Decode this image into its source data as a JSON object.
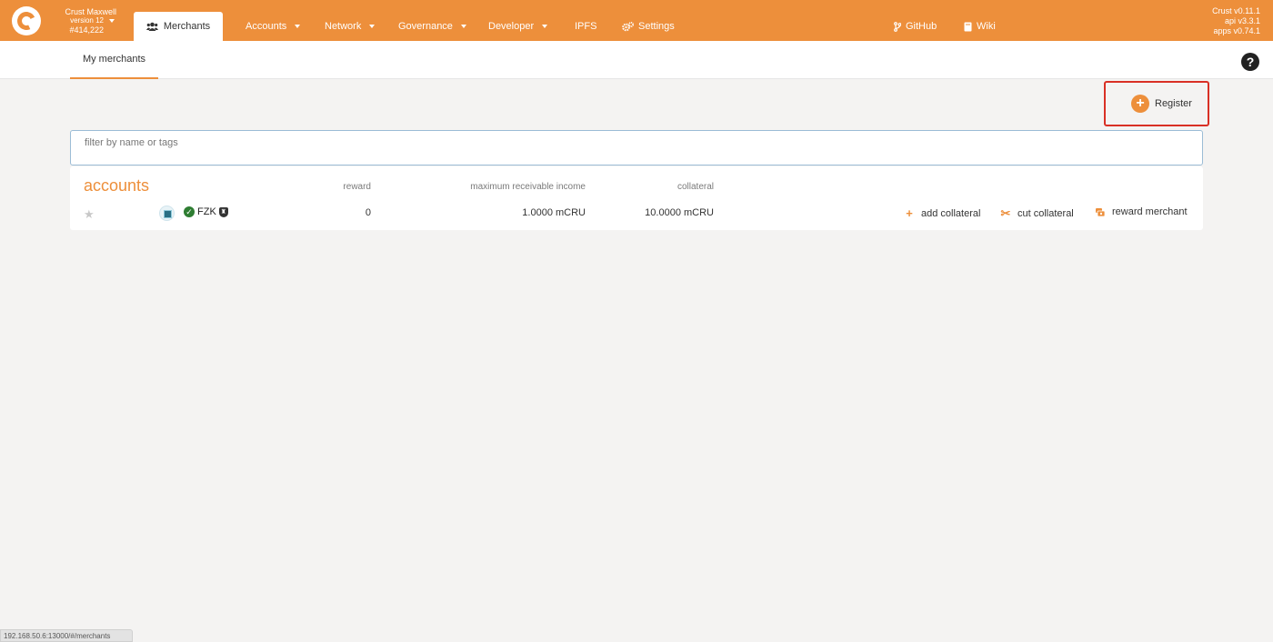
{
  "header": {
    "chain_name": "Crust Maxwell",
    "version": "version 12",
    "block": "#414,222",
    "active_tab": "Merchants",
    "nav": [
      {
        "label": "Accounts"
      },
      {
        "label": "Network"
      },
      {
        "label": "Governance"
      },
      {
        "label": "Developer"
      },
      {
        "label": "IPFS"
      },
      {
        "label": "Settings"
      }
    ],
    "github": "GitHub",
    "wiki": "Wiki",
    "versions": [
      "Crust v0.11.1",
      "api v3.3.1",
      "apps v0.74.1"
    ]
  },
  "subnav": {
    "tab": "My merchants",
    "help": "?"
  },
  "register": {
    "label": "Register"
  },
  "filter": {
    "placeholder": "filter by name or tags"
  },
  "table": {
    "title": "accounts",
    "columns": {
      "reward": "reward",
      "income": "maximum receivable income",
      "collateral": "collateral"
    },
    "rows": [
      {
        "name": "FZK",
        "reward": "0",
        "income": "1.0000 mCRU",
        "collateral": "10.0000 mCRU",
        "actions": [
          "add collateral",
          "cut collateral",
          "reward merchant"
        ]
      }
    ]
  },
  "statusbar": "192.168.50.6:13000/#/merchants",
  "colors": {
    "brand": "#ed8f3b",
    "highlight": "#d93025"
  }
}
